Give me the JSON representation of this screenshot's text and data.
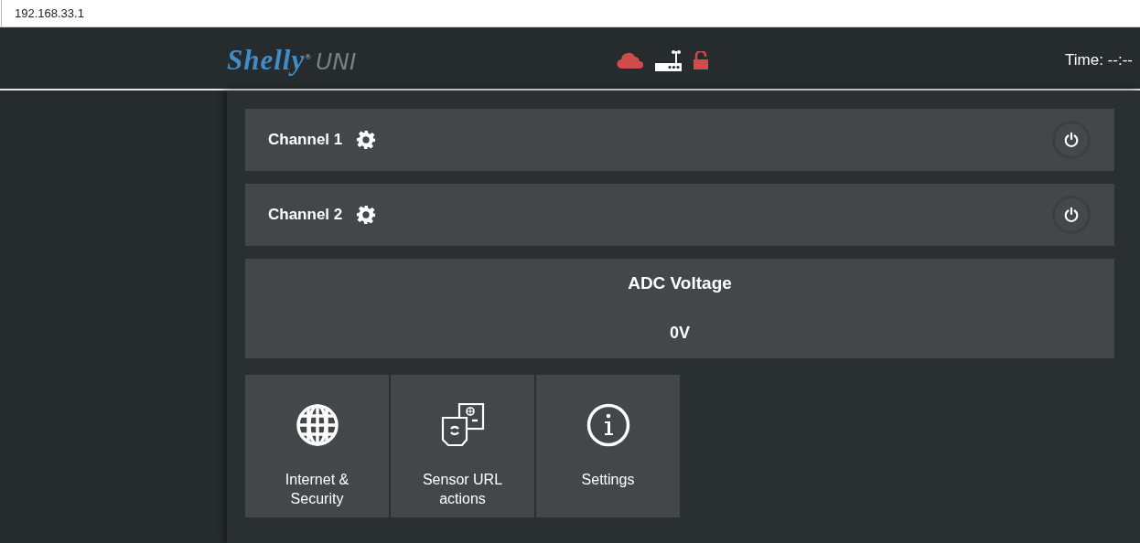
{
  "address_bar": {
    "url": "192.168.33.1"
  },
  "header": {
    "logo_brand": "Shelly$^{®}$",
    "logo_model": "UNI",
    "cloud_connected": false,
    "secured": false,
    "time_label": "Time: --:--"
  },
  "channels": [
    {
      "name": "Channel 1",
      "on": false
    },
    {
      "name": "Channel 2",
      "on": false
    }
  ],
  "adc": {
    "title": "ADC Voltage",
    "value": "0V"
  },
  "tiles": [
    {
      "kind": "globe",
      "label": "Internet &\nSecurity"
    },
    {
      "kind": "sensor",
      "label": "Sensor URL\nactions"
    },
    {
      "kind": "info",
      "label": "Settings"
    }
  ]
}
